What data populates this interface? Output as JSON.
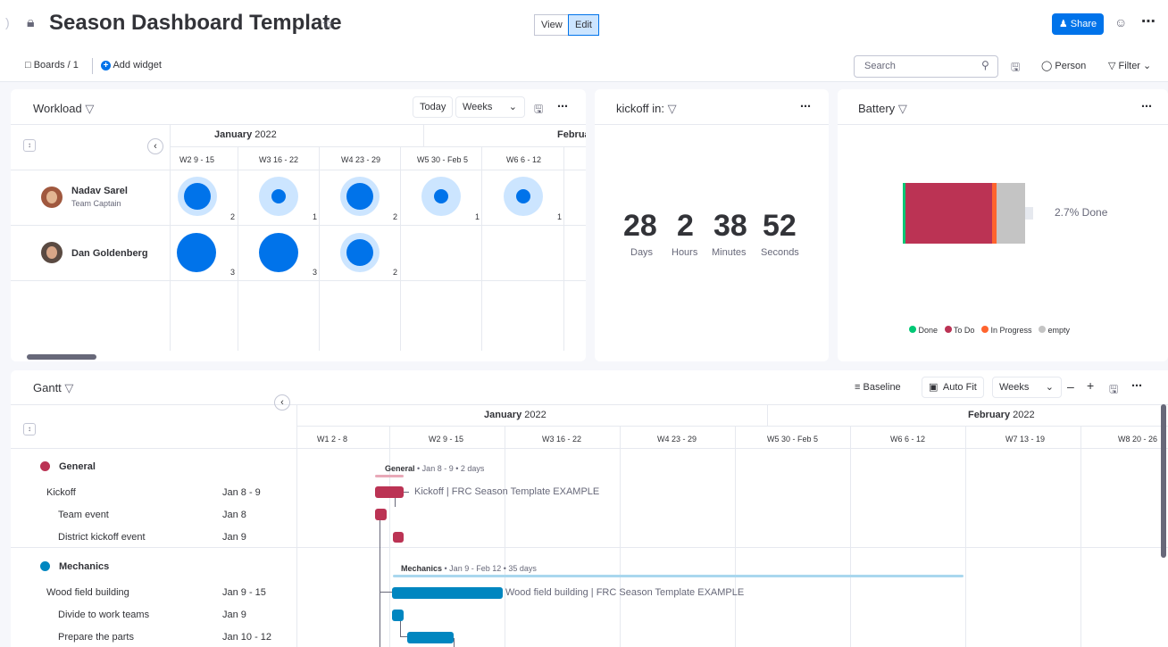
{
  "header": {
    "title": "Season Dashboard Template",
    "view_label": "View",
    "edit_label": "Edit",
    "share_label": "Share",
    "boards_label": "Boards / 1",
    "add_widget_label": "Add widget",
    "search_placeholder": "Search",
    "person_label": "Person",
    "filter_label": "Filter"
  },
  "workload": {
    "title": "Workload",
    "today_label": "Today",
    "weeks_label": "Weeks",
    "month1": "January",
    "month1_year": "2022",
    "month2": "Februa",
    "weeks": [
      "W2  9 - 15",
      "W3  16 - 22",
      "W4  23 - 29",
      "W5  30 - Feb 5",
      "W6  6 - 12"
    ],
    "people": [
      {
        "name": "Nadav Sarel",
        "role": "Team Captain",
        "counts": [
          "2",
          "1",
          "2",
          "1",
          "1"
        ]
      },
      {
        "name": "Dan Goldenberg",
        "role": "",
        "counts": [
          "3",
          "3",
          "2",
          "",
          ""
        ]
      }
    ]
  },
  "countdown": {
    "title": "kickoff in:",
    "days": "28",
    "hours": "2",
    "minutes": "38",
    "seconds": "52",
    "days_label": "Days",
    "hours_label": "Hours",
    "minutes_label": "Minutes",
    "seconds_label": "Seconds"
  },
  "battery": {
    "title": "Battery",
    "done_text": "2.7% Done",
    "legend": [
      "Done",
      "To Do",
      "In Progress",
      "empty"
    ],
    "colors": {
      "done": "#00c875",
      "todo": "#bb3354",
      "in_progress": "#ff642e",
      "empty": "#c4c4c4"
    }
  },
  "gantt": {
    "title": "Gantt",
    "baseline_label": "Baseline",
    "autofit_label": "Auto Fit",
    "weeks_label": "Weeks",
    "month1": "January",
    "month1_year": "2022",
    "month2": "February",
    "month2_year": "2022",
    "weeks": [
      "W1  2 - 8",
      "W2  9 - 15",
      "W3  16 - 22",
      "W4  23 - 29",
      "W5  30 - Feb 5",
      "W6  6 - 12",
      "W7  13 - 19",
      "W8  20 - 26"
    ],
    "groups": [
      {
        "name": "General",
        "color": "#bb3354",
        "summary": "General • Jan 8 - 9 • 2 days",
        "summary_bold": "General",
        "summary_rest": " • Jan 8 - 9 • 2 days"
      },
      {
        "name": "Mechanics",
        "color": "#0086c0",
        "summary_bold": "Mechanics",
        "summary_rest": " • Jan 9 - Feb 12 • 35 days"
      }
    ],
    "rows": [
      {
        "name": "Kickoff",
        "date": "Jan 8 - 9",
        "label": "Kickoff | FRC Season Template EXAMPLE"
      },
      {
        "name": "Team event",
        "date": "Jan 8"
      },
      {
        "name": "District kickoff event",
        "date": "Jan 9"
      },
      {
        "name": "Wood field building",
        "date": "Jan 9 - 15",
        "label": "Wood field building | FRC Season Template EXAMPLE"
      },
      {
        "name": "Divide to work teams",
        "date": "Jan 9"
      },
      {
        "name": "Prepare the parts",
        "date": "Jan 10 - 12"
      }
    ]
  }
}
